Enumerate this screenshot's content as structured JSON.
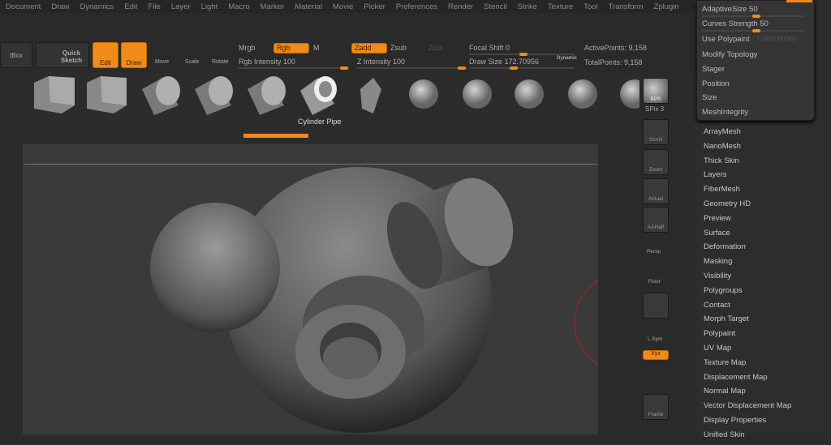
{
  "menu": [
    "Document",
    "Draw",
    "Dynamics",
    "Edit",
    "File",
    "Layer",
    "Light",
    "Macro",
    "Marker",
    "Material",
    "Movie",
    "Picker",
    "Preferences",
    "Render",
    "Stencil",
    "Strike",
    "Texture",
    "Tool",
    "Transform",
    "Zplugin"
  ],
  "shelf": {
    "lightbox": "tBox",
    "quick_sketch": "Quick Sketch",
    "edit": "Edit",
    "draw": "Draw",
    "move": "Move",
    "scale": "Scale",
    "rotate": "Rotate",
    "mrgb": "Mrgb",
    "rgb": "Rgb",
    "m": "M",
    "rgb_intensity": "Rgb Intensity 100",
    "zadd": "Zadd",
    "zsub": "Zsub",
    "zcut": "Zcut",
    "z_intensity": "Z Intensity 100",
    "focal_shift": "Focal Shift 0",
    "draw_size": "Draw Size 172.70956",
    "dynamic": "Dynamic",
    "active_points": "ActivePoints: 9,158",
    "total_points": "TotalPoints: 9,158",
    "accent": "#f08a19"
  },
  "tools": {
    "selected_label": "Cylinder Pipe",
    "values": {
      "rgb_intensity": 100,
      "z_intensity": 100,
      "focal_shift": 0,
      "draw_size": 172.70956
    }
  },
  "right_shelf": {
    "bpr": "BPR",
    "spix": "SPix 3",
    "scroll": "Scroll",
    "zoom": "Zoom",
    "actual": "Actual",
    "aahalf": "AAHalf",
    "persp": "Persp",
    "floor": "Floor",
    "local": "Local",
    "lsym": "L.Sym",
    "xyz": "Xyz",
    "frame": "Frame"
  },
  "popup": {
    "adaptive_size": "AdaptiveSize 50",
    "curves_strength": "Curves Strength 50",
    "use_polypaint": "Use Polypaint",
    "color_intensity": "ColorIntensity",
    "modify_topology": "Modify Topology",
    "stager": "Stager",
    "position": "Position",
    "size": "Size",
    "mesh_integrity": "MeshIntegrity"
  },
  "tool_menu": [
    "ArrayMesh",
    "NanoMesh",
    "Thick Skin",
    "Layers",
    "FiberMesh",
    "Geometry HD",
    "Preview",
    "Surface",
    "Deformation",
    "Masking",
    "Visibility",
    "Polygroups",
    "Contact",
    "Morph Target",
    "Polypaint",
    "UV Map",
    "Texture Map",
    "Displacement Map",
    "Normal Map",
    "Vector Displacement Map",
    "Display Properties",
    "Unified Skin"
  ]
}
